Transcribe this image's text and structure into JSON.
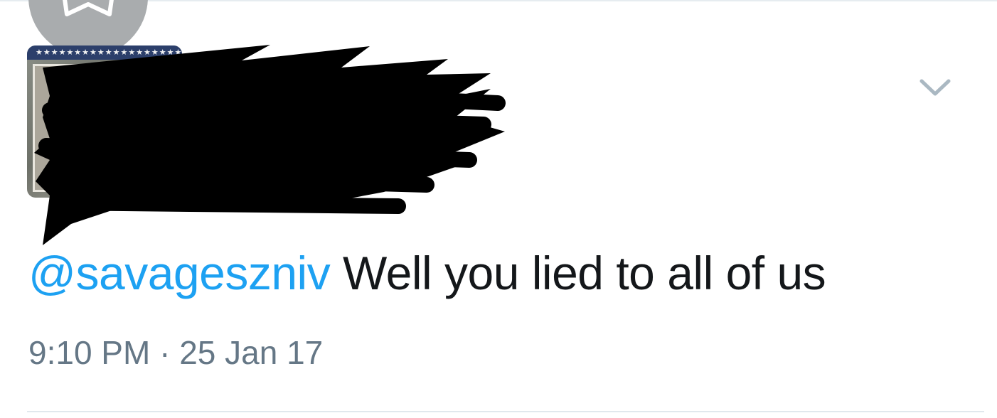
{
  "top_action": {
    "icon": "star-outline-icon"
  },
  "author": {
    "avatar": {
      "stars_text": "★★★★★★★★★★★★★★★★★★★★★★★★★★★★★"
    },
    "name_redacted": true
  },
  "menu": {
    "icon": "chevron-down-icon"
  },
  "tweet": {
    "mention": "@savageszniv",
    "body": " Well you lied to all of us",
    "timestamp": "9:10 PM · 25 Jan 17"
  },
  "colors": {
    "mention": "#1da1f2",
    "text": "#14171a",
    "meta": "#657786",
    "chevron": "#aab8c2",
    "fab": "#a9acae"
  }
}
